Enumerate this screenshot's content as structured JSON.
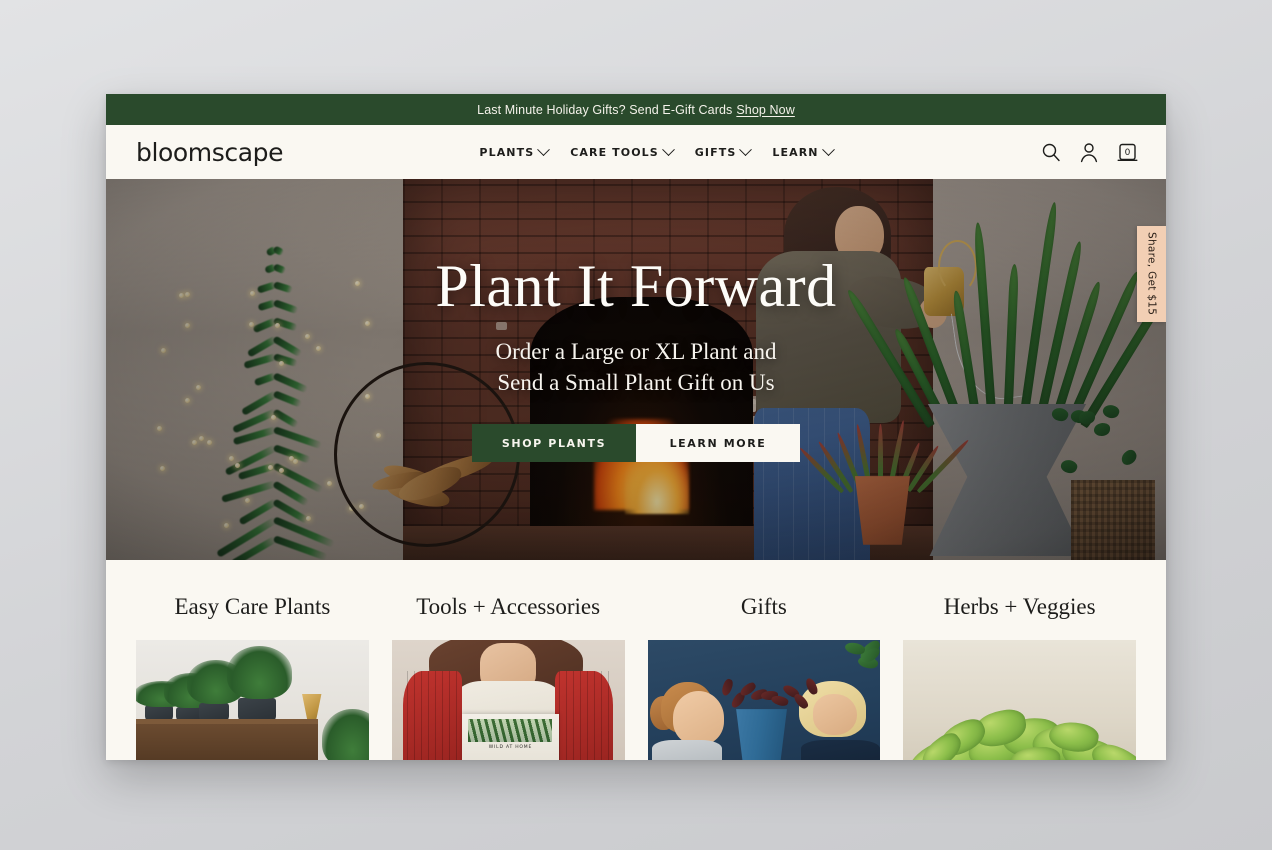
{
  "announcement": {
    "text": "Last Minute Holiday Gifts? Send E-Gift Cards",
    "link_label": "Shop Now",
    "background_color": "#2a4a2c"
  },
  "header": {
    "logo": "bloomscape",
    "nav": [
      {
        "label": "PLANTS",
        "has_dropdown": true
      },
      {
        "label": "CARE TOOLS",
        "has_dropdown": true
      },
      {
        "label": "GIFTS",
        "has_dropdown": true
      },
      {
        "label": "LEARN",
        "has_dropdown": true
      }
    ],
    "icons": {
      "search": "search-icon",
      "account": "account-icon",
      "cart": "cart-icon",
      "cart_count": "0"
    },
    "background_color": "#faf8f2"
  },
  "hero": {
    "title": "Plant It Forward",
    "subtitle_line1": "Order a Large or XL Plant and",
    "subtitle_line2": "Send a Small Plant Gift on Us",
    "primary_button": "SHOP PLANTS",
    "secondary_button": "LEARN MORE",
    "primary_button_color": "#2a4a2c",
    "secondary_button_color": "#faf8f2"
  },
  "share_tab": {
    "label": "Share, Get $15",
    "background_color": "#f2cfb4"
  },
  "categories": [
    {
      "title": "Easy Care Plants",
      "image_alt": "plants on a wooden shelf with gold watering can"
    },
    {
      "title": "Tools + Accessories",
      "image_alt": "woman in red cardigan holding Wild at Home book"
    },
    {
      "title": "Gifts",
      "image_alt": "girl and woman holding a potted plant on navy background"
    },
    {
      "title": "Herbs + Veggies",
      "image_alt": "fresh basil leaves on cream background"
    }
  ],
  "book_cover_title": "WILD AT HOME"
}
